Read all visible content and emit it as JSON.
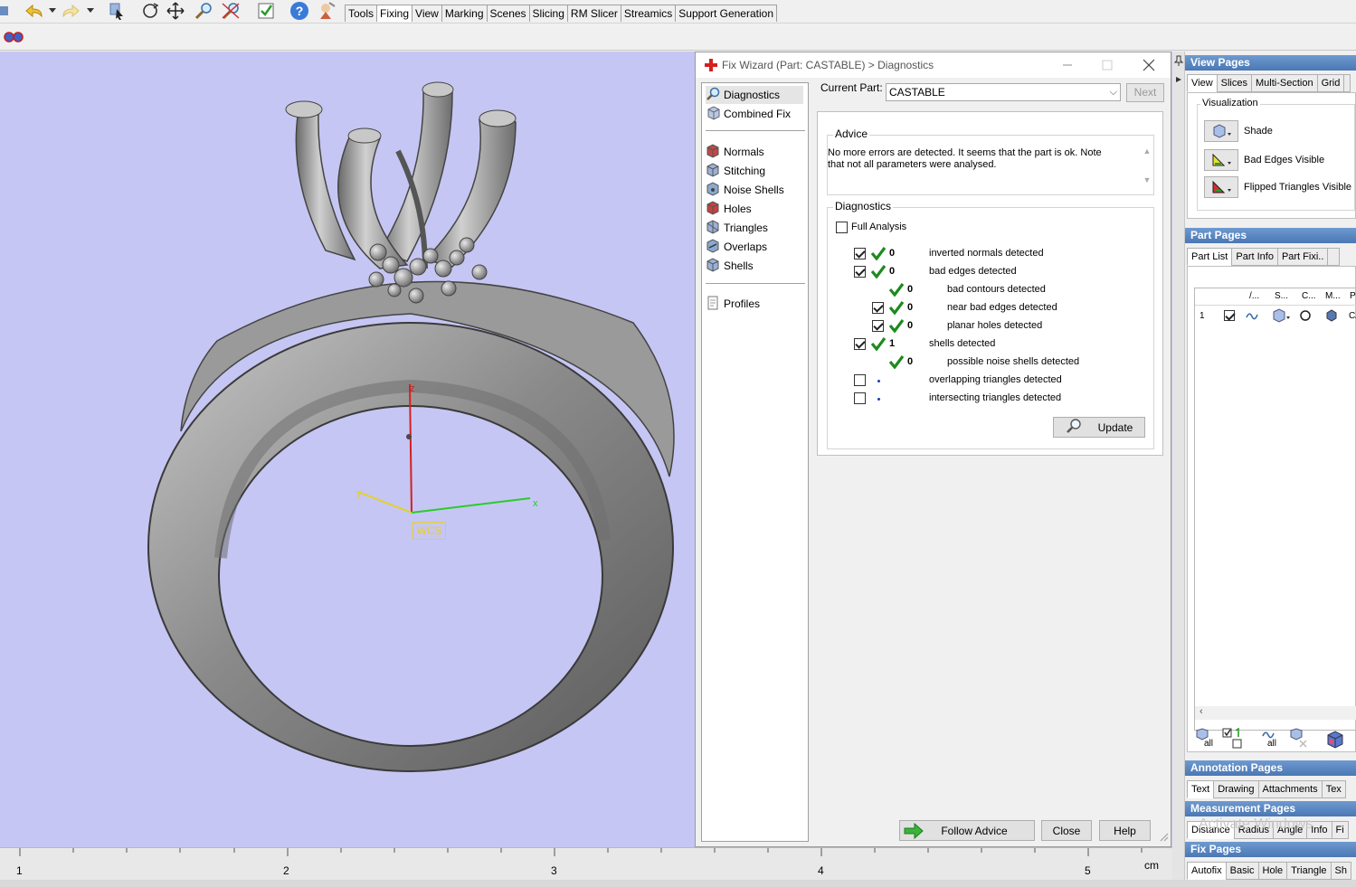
{
  "toolbar": {
    "tabs": [
      "Tools",
      "Fixing",
      "View",
      "Marking",
      "Scenes",
      "Slicing",
      "RM Slicer",
      "Streamics",
      "Support Generation"
    ],
    "active_tab": "Fixing"
  },
  "viewport": {
    "axes": {
      "z": "z",
      "y": "y",
      "x": "x",
      "wcs": "WCS"
    },
    "background": "#c6c6f4"
  },
  "ruler": {
    "ticks": [
      "1",
      "2",
      "3",
      "4",
      "5"
    ],
    "unit": "cm"
  },
  "wizard": {
    "title": "Fix Wizard (Part: CASTABLE) > Diagnostics",
    "nav": {
      "top": [
        "Diagnostics",
        "Combined Fix"
      ],
      "middle": [
        "Normals",
        "Stitching",
        "Noise Shells",
        "Holes",
        "Triangles",
        "Overlaps",
        "Shells"
      ],
      "bottom": [
        "Profiles"
      ]
    },
    "current_part_label": "Current Part:",
    "current_part_value": "CASTABLE",
    "next_label": "Next",
    "advice": {
      "title": "Advice",
      "text": "No more errors are detected. It seems that the part is ok. Note that not all parameters were analysed."
    },
    "diagnostics": {
      "title": "Diagnostics",
      "full_analysis": "Full Analysis",
      "rows": [
        {
          "num": "0",
          "label": "inverted normals detected",
          "checked": true,
          "status": "ok",
          "indent": 0
        },
        {
          "num": "0",
          "label": "bad edges detected",
          "checked": true,
          "status": "ok",
          "indent": 0
        },
        {
          "num": "0",
          "label": "bad contours detected",
          "checked": null,
          "status": "ok",
          "indent": 1
        },
        {
          "num": "0",
          "label": "near bad edges detected",
          "checked": true,
          "status": "ok",
          "indent": 1
        },
        {
          "num": "0",
          "label": "planar holes detected",
          "checked": true,
          "status": "ok",
          "indent": 1
        },
        {
          "num": "1",
          "label": "shells detected",
          "checked": true,
          "status": "ok",
          "indent": 0
        },
        {
          "num": "0",
          "label": "possible noise shells detected",
          "checked": null,
          "status": "ok",
          "indent": 1
        },
        {
          "num": "",
          "label": "overlapping triangles detected",
          "checked": false,
          "status": "none",
          "indent": 0
        },
        {
          "num": "",
          "label": "intersecting triangles detected",
          "checked": false,
          "status": "none",
          "indent": 0
        }
      ]
    },
    "update_label": "Update",
    "follow_advice_label": "Follow Advice",
    "close_label": "Close",
    "help_label": "Help"
  },
  "dock": {
    "view_pages": {
      "title": "View Pages",
      "tabs": [
        "View",
        "Slices",
        "Multi-Section",
        "Grid"
      ],
      "visualization_title": "Visualization",
      "items": [
        "Shade",
        "Bad Edges Visible",
        "Flipped Triangles Visible"
      ]
    },
    "part_pages": {
      "title": "Part Pages",
      "tabs": [
        "Part List",
        "Part Info",
        "Part Fixi.."
      ],
      "columns": [
        "/...",
        "S...",
        "C...",
        "M...",
        "Pa"
      ],
      "row_index": "1",
      "row_name": "CA",
      "all_label": "all"
    },
    "annotation_pages": {
      "title": "Annotation Pages",
      "tabs": [
        "Text",
        "Drawing",
        "Attachments",
        "Tex"
      ]
    },
    "measurement_pages": {
      "title": "Measurement Pages",
      "tabs": [
        "Distance",
        "Radius",
        "Angle",
        "Info",
        "Fi"
      ]
    },
    "fix_pages": {
      "title": "Fix Pages",
      "tabs": [
        "Autofix",
        "Basic",
        "Hole",
        "Triangle",
        "Sh"
      ]
    },
    "watermark": "Activate Windows"
  }
}
